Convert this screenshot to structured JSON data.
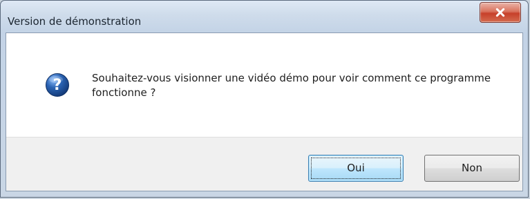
{
  "window": {
    "title": "Version de démonstration",
    "close_icon": "close-icon"
  },
  "dialog": {
    "icon": "question-icon",
    "message": "Souhaitez-vous visionner une vidéo démo pour voir comment ce programme fonctionne ?"
  },
  "buttons": {
    "yes_label": "Oui",
    "no_label": "Non"
  },
  "colors": {
    "question_icon_blue": "#2b64b4",
    "close_button_red": "#c7402a",
    "footer_bg": "#f0f0f0",
    "primary_button_border": "#3c7fb1"
  }
}
